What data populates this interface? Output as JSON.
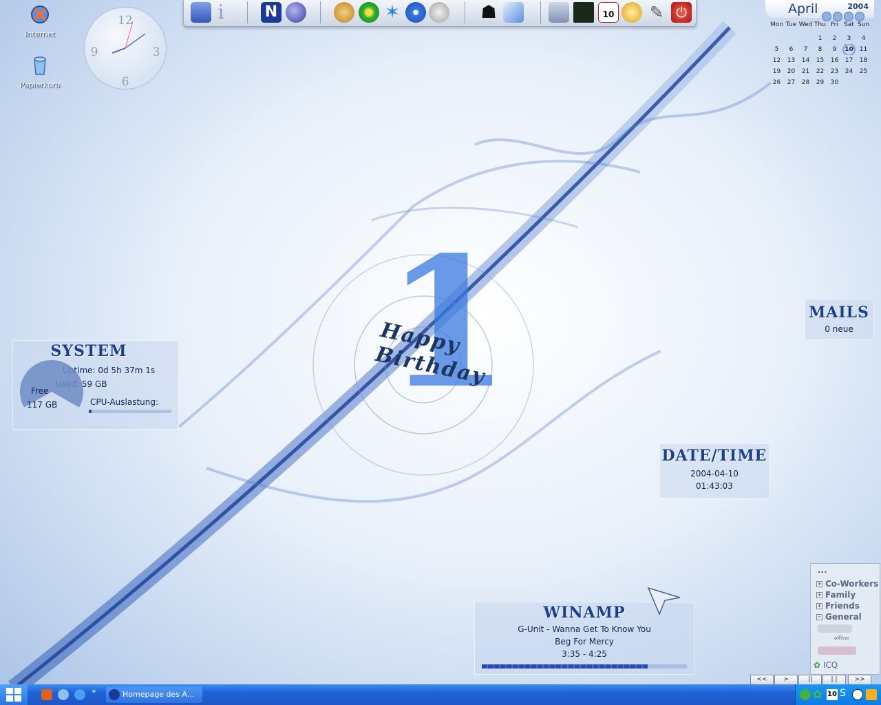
{
  "desktop_icons": [
    {
      "label": "Internet",
      "icon": "internet-explorer-icon"
    },
    {
      "label": "Papierkorb",
      "icon": "recycle-bin-icon"
    }
  ],
  "clock": {
    "numerals": [
      "12",
      "3",
      "6",
      "9"
    ]
  },
  "launchbar_icons": [
    "my-computer-icon",
    "info-icon",
    "netscape-icon",
    "browser-icon",
    "phone-icon",
    "icq-flower-icon",
    "messenger-icon",
    "dvd-icon",
    "media-player-icon",
    "user-icon",
    "notepad-icon",
    "tools-icon",
    "performance-icon",
    "calendar-icon",
    "clock-icon",
    "tips-icon",
    "shutdown-icon"
  ],
  "calendar": {
    "month": "April",
    "year": "2004",
    "weekdays": [
      "Mon",
      "Tue",
      "Wed",
      "Thu",
      "Fri",
      "Sat",
      "Sun"
    ],
    "weeks": [
      [
        "",
        "",
        "",
        "1",
        "2",
        "3",
        "4"
      ],
      [
        "5",
        "6",
        "7",
        "8",
        "9",
        "10",
        "11"
      ],
      [
        "12",
        "13",
        "14",
        "15",
        "16",
        "17",
        "18"
      ],
      [
        "19",
        "20",
        "21",
        "22",
        "23",
        "24",
        "25"
      ],
      [
        "26",
        "27",
        "28",
        "29",
        "30",
        "",
        ""
      ]
    ],
    "today": "10"
  },
  "wallpaper": {
    "line1": "Happy",
    "line2": "Birthday",
    "number": "1"
  },
  "system": {
    "title": "SYSTEM",
    "uptime": "Uptime: 0d 5h 37m 1s",
    "used": "Used: 59 GB",
    "free_label": "Free",
    "free_value": "117 GB",
    "cpu_label": "CPU-Auslastung:",
    "disk_free_fraction": 0.665,
    "cpu_fraction": 0.03
  },
  "mails": {
    "title": "MAILS",
    "count_text": "0 neue"
  },
  "datetime": {
    "title": "DATE/TIME",
    "date": "2004-04-10",
    "time": "01:43:03"
  },
  "winamp": {
    "title": "WINAMP",
    "track": "G-Unit - Wanna Get To Know You",
    "album": "Beg For Mercy",
    "time": "3:35 - 4:25",
    "progress_fraction": 0.81,
    "controls": [
      "<<",
      ">",
      "||",
      "| |",
      ">>"
    ]
  },
  "icq": {
    "header": "...",
    "groups": [
      {
        "label": "Co-Workers",
        "expanded": false
      },
      {
        "label": "Family",
        "expanded": false
      },
      {
        "label": "Friends",
        "expanded": false
      },
      {
        "label": "General",
        "expanded": true
      }
    ],
    "offline_label": "offline",
    "footer_label": "ICQ"
  },
  "taskbar": {
    "quicklaunch": [
      "opera-icon",
      "ie-icon",
      "messenger-icon"
    ],
    "more": "»",
    "task_label": "Homepage des A...",
    "tray_icons": [
      "network-icon",
      "icq-tray-icon",
      "calendar-tray-icon",
      "sound-icon",
      "clock-tray-icon",
      "security-icon"
    ],
    "tray_calendar_day": "10"
  }
}
